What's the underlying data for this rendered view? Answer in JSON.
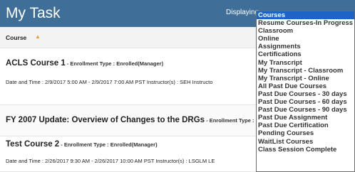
{
  "header": {
    "title": "My Task",
    "display_label": "Displaying"
  },
  "list": {
    "sort_column": "Course",
    "sort_indicator": "▲"
  },
  "courses": [
    {
      "title": "ACLS Course 1",
      "meta": " - Enrollment Type : Enrolled(Manager)",
      "detail": "Date and Time : 2/9/2017 5:00 AM - 2/9/2017 7:00 AM PST Instructor(s) : SEH Instructo"
    },
    {
      "title": "FY 2007 Update: Overview of Changes to the DRGs",
      "meta": " - Enrollment Type : Enroll",
      "detail": ""
    },
    {
      "title": "Test Course 2",
      "meta": " - Enrollment Type : Enrolled(Manager)",
      "detail": "Date and Time : 2/26/2017 9:30 AM - 2/26/2017 10:00 AM PST Instructor(s) : LSGLM LE"
    }
  ],
  "dropdown": {
    "selected": "Courses",
    "options": [
      "Courses",
      "Resume Courses-In Progress",
      "Classroom",
      "Online",
      "Assignments",
      "Certifications",
      "My Transcript",
      "My Transcript - Classroom",
      "My Transcript - Online",
      "All Past Due Courses",
      "Past Due Courses - 30 days",
      "Past Due Courses - 60 days",
      "Past Due Courses - 90 days",
      "Past Due Assignment",
      "Past Due Certification",
      "Pending Courses",
      "WaitList Courses",
      "Class Session Complete"
    ]
  },
  "colors": {
    "header_bg": "#3f6f98",
    "selected_option_bg": "#1e63c6",
    "sort_arrow": "#e5a030"
  }
}
